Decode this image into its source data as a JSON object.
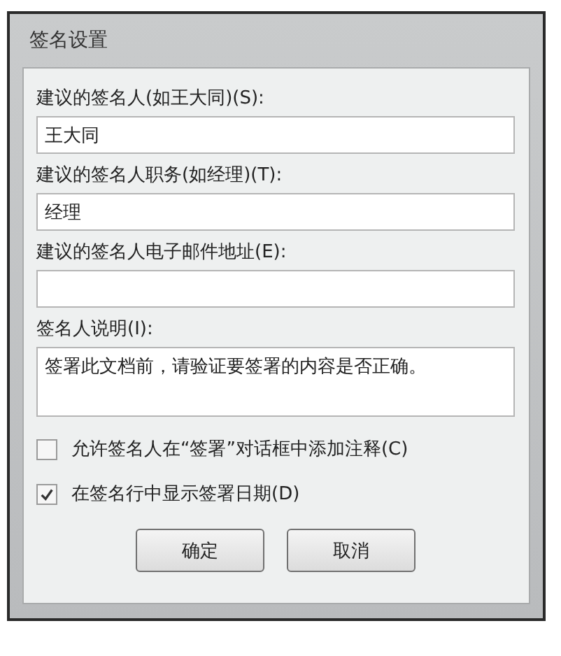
{
  "window": {
    "title": "签名设置"
  },
  "fields": [
    {
      "label": "建议的签名人(如王大同)(S):",
      "value": "王大同",
      "kind": "line"
    },
    {
      "label": "建议的签名人职务(如经理)(T):",
      "value": "经理",
      "kind": "line"
    },
    {
      "label": "建议的签名人电子邮件地址(E):",
      "kind": "line"
    },
    {
      "label": "签名人说明(I):",
      "value": "签署此文档前，请验证要签署的内容是否正确。",
      "kind": "area"
    }
  ],
  "checkboxes": [
    {
      "label": "允许签名人在“签署”对话框中添加注释(C)",
      "checked": false
    },
    {
      "label": "在签名行中显示签署日期(D)",
      "checked": true
    }
  ],
  "buttons": [
    "确定",
    "取消"
  ]
}
